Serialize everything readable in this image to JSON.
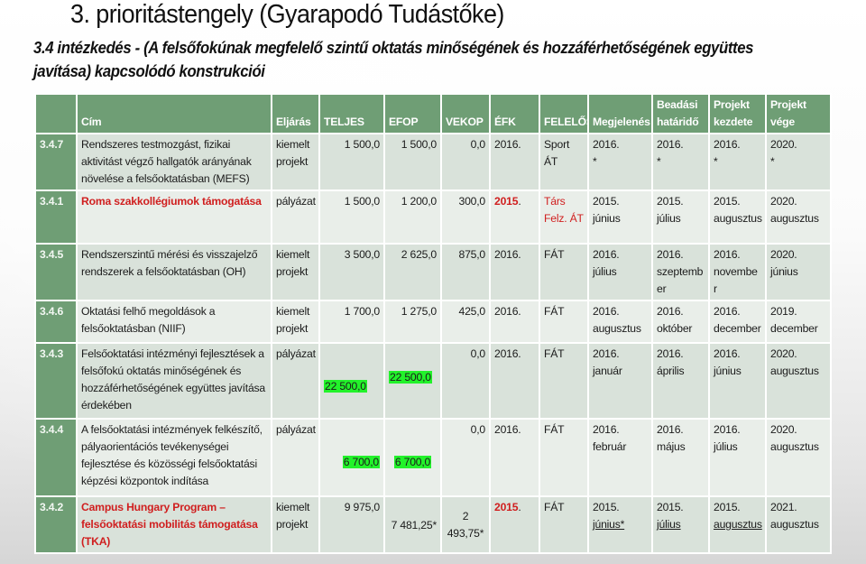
{
  "title": "3. prioritástengely (Gyarapodó Tudástőke)",
  "subtitle": "3.4 intézkedés  - (A felsőfokúnak megfelelő szintű oktatás minőségének és hozzáférhetőségének együttes javítása) kapcsolódó konstrukciói",
  "colors": {
    "header_green": "#6f9e75",
    "row_dark": "#d9e2da",
    "row_light": "#e9eee9",
    "highlight_red": "#d01f1f",
    "highlight_green": "#22f22a"
  },
  "table": {
    "headers": {
      "id": "",
      "cim": "Cím",
      "eljaras": "Eljárás",
      "teljes": "TELJES",
      "efop": "EFOP",
      "vekop": "VEKOP",
      "efk": "ÉFK",
      "felelos": "FELELŐS",
      "megjelenes": "Megjelenés",
      "beadasi_1": "Beadási",
      "beadasi_2": "határidő",
      "kezdete_1": "Projekt",
      "kezdete_2": "kezdete",
      "vege_1": "Projekt",
      "vege_2": "vége"
    },
    "rows": [
      {
        "id": "3.4.7",
        "cim": "Rendszeres testmozgást, fizikai aktivitást végző hallgatók arányának növelése a felsőoktatásban (MEFS)",
        "eljaras_1": "kiemelt",
        "eljaras_2": "projekt",
        "teljes": "1 500,0",
        "efop": "1 500,0",
        "vekop": "0,0",
        "efk": "2016.",
        "felelos": "Sport ÁT",
        "megjelenes_1": "2016.",
        "megjelenes_2": "*",
        "beadasi_1": "2016.",
        "beadasi_2": "*",
        "kezdete_1": "2016.",
        "kezdete_2": "*",
        "vege_1": "2020.",
        "vege_2": "*"
      },
      {
        "id": "3.4.1",
        "cim": "Roma szakkollégiumok támogatása",
        "eljaras_1": "pályázat",
        "teljes": "1 500,0",
        "efop": "1 200,0",
        "vekop": "300,0",
        "efk_red": "2015",
        "efk_suffix": ".",
        "felelos_1": "Társ",
        "felelos_2": "Felz. ÁT",
        "megjelenes_1": "2015.",
        "megjelenes_2": "június",
        "beadasi_1": "2015.",
        "beadasi_2": "július",
        "kezdete_1": "2015.",
        "kezdete_2": "augusztus",
        "vege_1": "2020.",
        "vege_2": "augusztus"
      },
      {
        "id": "3.4.5",
        "cim": "Rendszerszintű mérési és visszajelző rendszerek a felsőoktatásban (OH)",
        "eljaras_1": "kiemelt",
        "eljaras_2": "projekt",
        "teljes": "3 500,0",
        "efop": "2 625,0",
        "vekop": "875,0",
        "efk": "2016.",
        "felelos": "FÁT",
        "megjelenes_1": "2016.",
        "megjelenes_2": "július",
        "beadasi_1": "2016.",
        "beadasi_2": "szeptemb",
        "beadasi_3": "er",
        "kezdete_1": "2016.",
        "kezdete_2": "novembe",
        "kezdete_3": "r",
        "vege_1": "2020.",
        "vege_2": "június"
      },
      {
        "id": "3.4.6",
        "cim": "Oktatási felhő megoldások a felsőoktatásban (NIIF)",
        "eljaras_1": "kiemelt",
        "eljaras_2": "projekt",
        "teljes": "1 700,0",
        "efop": "1 275,0",
        "vekop": "425,0",
        "efk": "2016.",
        "felelos": "FÁT",
        "megjelenes_1": "2016.",
        "megjelenes_2": "augusztus",
        "beadasi_1": "2016.",
        "beadasi_2": "október",
        "kezdete_1": "2016.",
        "kezdete_2": "december",
        "vege_1": "2019.",
        "vege_2": "december"
      },
      {
        "id": "3.4.3",
        "cim": "Felsőoktatási intézményi fejlesztések a felsőfokú oktatás minőségének és hozzáférhetőségének együttes javítása érdekében",
        "eljaras_1": "pályázat",
        "teljes": "22 500,0",
        "efop": "22 500,0",
        "vekop": "0,0",
        "efk": "2016.",
        "felelos": "FÁT",
        "megjelenes_1": "2016.",
        "megjelenes_2": "január",
        "beadasi_1": "2016.",
        "beadasi_2": "április",
        "kezdete_1": "2016.",
        "kezdete_2": "június",
        "vege_1": "2020.",
        "vege_2": "augusztus"
      },
      {
        "id": "3.4.4",
        "cim": "A felsőoktatási intézmények felkészítő, pályaorientációs tevékenységei fejlesztése és közösségi felsőoktatási képzési központok indítása",
        "eljaras_1": "pályázat",
        "teljes": "6 700,0",
        "efop": "6 700,0",
        "vekop": "0,0",
        "efk": "2016.",
        "felelos": "FÁT",
        "megjelenes_1": "2016.",
        "megjelenes_2": "február",
        "beadasi_1": "2016.",
        "beadasi_2": "május",
        "kezdete_1": "2016.",
        "kezdete_2": "július",
        "vege_1": "2020.",
        "vege_2": "augusztus"
      },
      {
        "id": "3.4.2",
        "cim": "Campus Hungary Program – felsőoktatási mobilitás támogatása (TKA)",
        "eljaras_1": "kiemelt",
        "eljaras_2": "projekt",
        "teljes": "9 975,0",
        "efop": "7 481,25*",
        "vekop_1": "2",
        "vekop_2": "493,75*",
        "efk_red": "2015",
        "efk_suffix": ".",
        "felelos": "FÁT",
        "megjelenes_1": "2015.",
        "megjelenes_2": "június*",
        "beadasi_1": "2015.",
        "beadasi_2": "július",
        "kezdete_1": "2015.",
        "kezdete_2": "augusztus",
        "vege_1": "2021.",
        "vege_2": "augusztus"
      }
    ]
  }
}
